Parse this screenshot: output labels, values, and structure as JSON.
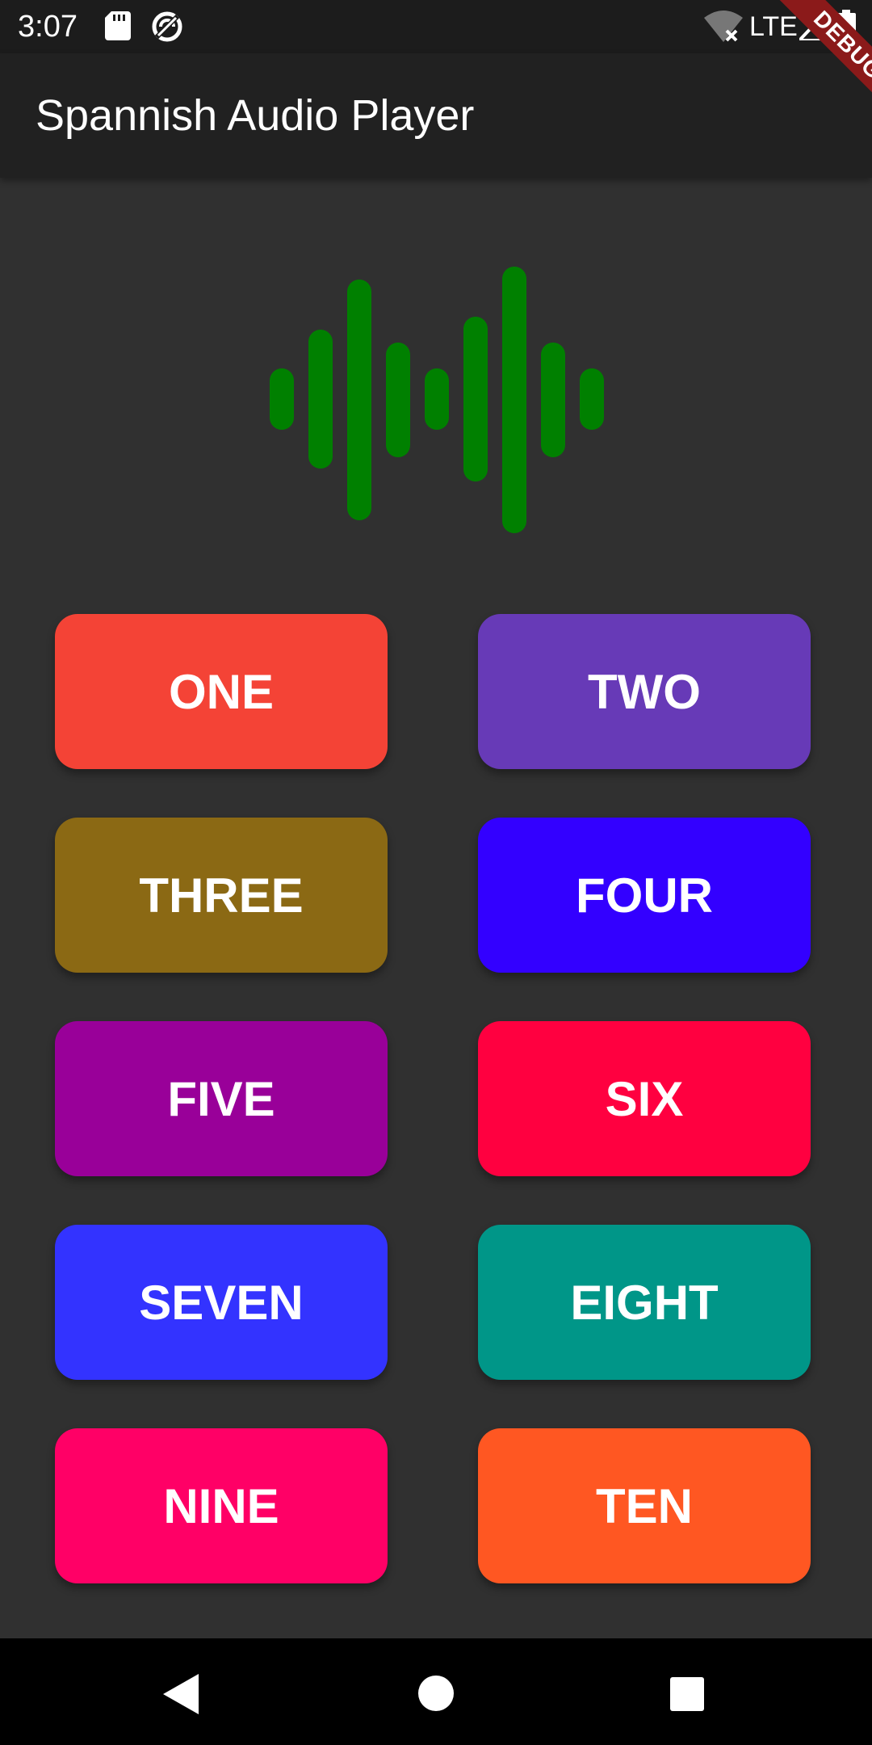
{
  "status_bar": {
    "time": "3:07",
    "network": "LTE",
    "icons": [
      "sd-card-icon",
      "sync-icon",
      "wifi-icon",
      "signal-icon",
      "battery-icon"
    ]
  },
  "app_bar": {
    "title": "Spannish Audio Player"
  },
  "debug_banner": {
    "label": "DEBUG",
    "color": "#8b1a1a"
  },
  "waveform": {
    "icon": "waveform-icon",
    "color": "#008000"
  },
  "buttons": [
    {
      "label": "ONE",
      "color": "#F44336"
    },
    {
      "label": "TWO",
      "color": "#673AB7"
    },
    {
      "label": "THREE",
      "color": "#8B6914"
    },
    {
      "label": "FOUR",
      "color": "#3300FF"
    },
    {
      "label": "FIVE",
      "color": "#990099"
    },
    {
      "label": "SIX",
      "color": "#FF0040"
    },
    {
      "label": "SEVEN",
      "color": "#3333FF"
    },
    {
      "label": "EIGHT",
      "color": "#009688"
    },
    {
      "label": "NINE",
      "color": "#FF0066"
    },
    {
      "label": "TEN",
      "color": "#FF5722"
    }
  ],
  "nav_bar": {
    "icons": [
      "back-icon",
      "home-icon",
      "recents-icon"
    ]
  }
}
